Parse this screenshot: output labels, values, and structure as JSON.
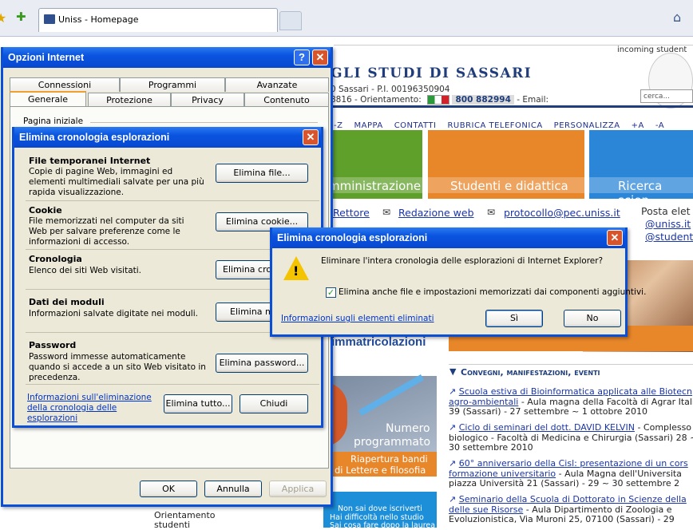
{
  "browser": {
    "tab_title": "Uniss - Homepage"
  },
  "site": {
    "header_right": "incoming student",
    "university_name": "GLI STUDI DI SASSARI",
    "address_line": "0 Sassari - P.I. 00196350904",
    "contact_line_prefix": "8816 - Orientamento:",
    "phone": "800 882994",
    "email_label": "- Email:",
    "search_placeholder": "cerca...",
    "nav": [
      "-Z",
      "MAPPA",
      "CONTATTI",
      "RUBRICA TELEFONICA",
      "PERSONALIZZA",
      "+A",
      "-A"
    ],
    "categories": [
      "mministrazione",
      "Studenti e didattica",
      "Ricerca scien"
    ],
    "contacts": [
      "Rettore",
      "Redazione web",
      "protocollo@pec.uniss.it"
    ],
    "posta_label": "Posta elet",
    "posta_links": [
      "@uniss.it",
      "@student"
    ],
    "immatricolazioni": "immatricolazioni",
    "numero_title": "Numero",
    "numero_sub": "programmato",
    "riapertura": "Riapertura bandi",
    "lettere": "di Lettere e filosofia",
    "orientamento_label": "Orientamento studenti",
    "iscrizioni_1": "Non sai dove iscriverti",
    "iscrizioni_2": "Hai difficoltà nello studio",
    "iscrizioni_3": "Sai cosa fare dopo la laurea",
    "events_heading": "Convegni, manifestazioni, eventi",
    "events": [
      {
        "title": "Scuola estiva di Bioinformatica applicata alle Biotecn agro-ambientali",
        "detail": "- Aula magna della Facoltà di Agrar Italia 39 (Sassari) - 27 settembre ~ 1 ottobre 2010"
      },
      {
        "title": "Ciclo di seminari del dott. DAVID KELVIN",
        "detail": "- Complesso biologico - Facoltà di Medicina e Chirurgia (Sassari) 28 ~ 30 settembre 2010"
      },
      {
        "title": "60° anniversario della Cisl: presentazione di un cors formazione universitario",
        "detail": "- Aula Magna dell'Universita piazza Università 21 (Sassari) - 29 ~ 30 settembre 2"
      },
      {
        "title": "Seminario della Scuola di Dottorato in Scienze della delle sue Risorse",
        "detail": "- Aula Dipartimento di Zoologia e Evoluzionistica, Via Muroni 25, 07100 (Sassari) - 29"
      }
    ]
  },
  "internet_options": {
    "title": "Opzioni Internet",
    "tabs_back": [
      "Connessioni",
      "Programmi",
      "Avanzate"
    ],
    "tabs_front": [
      "Generale",
      "Protezione",
      "Privacy",
      "Contenuto"
    ],
    "group_label": "Pagina iniziale",
    "ok": "OK",
    "cancel": "Annulla",
    "apply": "Applica"
  },
  "delete_history": {
    "title": "Elimina cronologia esplorazioni",
    "sections": [
      {
        "title": "File temporanei Internet",
        "desc": "Copie di pagine Web, immagini ed elementi multimediali salvate per una più rapida visualizzazione.",
        "button": "Elimina file..."
      },
      {
        "title": "Cookie",
        "desc": "File memorizzati nel computer da siti Web per salvare preferenze come le informazioni di accesso.",
        "button": "Elimina cookie..."
      },
      {
        "title": "Cronologia",
        "desc": "Elenco dei siti Web visitati.",
        "button": "Elimina crono"
      },
      {
        "title": "Dati dei moduli",
        "desc": "Informazioni salvate digitate nei moduli.",
        "button": "Elimina mo"
      },
      {
        "title": "Password",
        "desc": "Password immesse automaticamente quando si accede a un sito Web visitato in precedenza.",
        "button": "Elimina password..."
      }
    ],
    "info_link": "Informazioni sull'eliminazione della cronologia delle esplorazioni",
    "delete_all": "Elimina tutto...",
    "close": "Chiudi"
  },
  "confirm": {
    "title": "Elimina cronologia esplorazioni",
    "message": "Eliminare l'intera cronologia delle esplorazioni di Internet Explorer?",
    "checkbox_label": "Elimina anche file e impostazioni memorizzati dai componenti aggiuntivi.",
    "checkbox_checked": true,
    "info_link": "Informazioni sugli elementi eliminati",
    "yes": "Sì",
    "no": "No"
  },
  "colors": {
    "xp_title_blue": "#0a54e0",
    "close_red": "#d9542b",
    "green_block": "#5fa02a",
    "orange_block": "#e8862a",
    "blue_block": "#2b86d8",
    "site_navy": "#1f3d7a"
  }
}
